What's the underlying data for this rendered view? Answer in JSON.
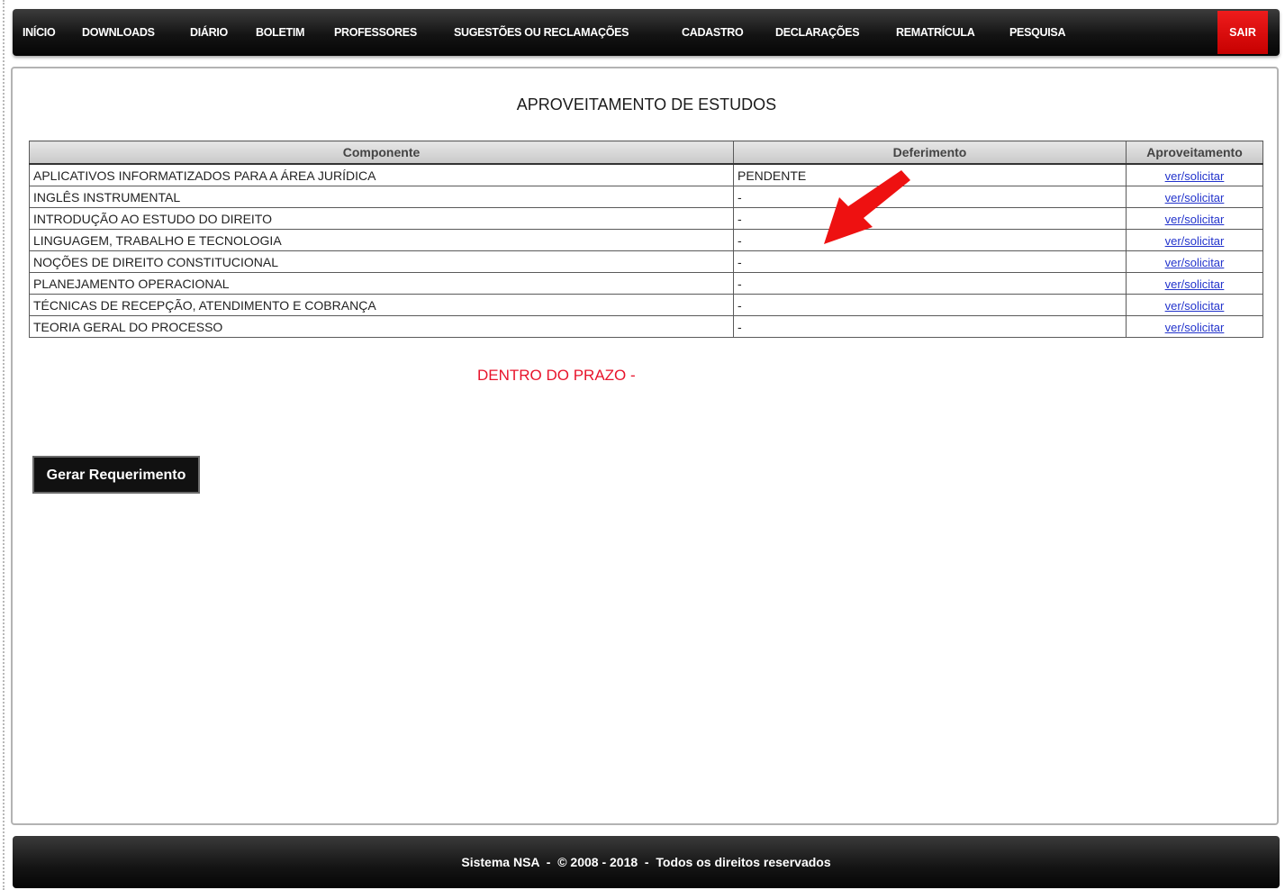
{
  "nav": {
    "items": [
      "INÍCIO",
      "DOWNLOADS",
      "DIÁRIO",
      "BOLETIM",
      "PROFESSORES",
      "SUGESTÕES OU RECLAMAÇÕES",
      "CADASTRO",
      "DECLARAÇÕES",
      "REMATRÍCULA",
      "PESQUISA"
    ],
    "logout_label": "SAIR"
  },
  "page": {
    "title": "APROVEITAMENTO DE ESTUDOS"
  },
  "table": {
    "headers": [
      "Componente",
      "Deferimento",
      "Aproveitamento"
    ],
    "rows": [
      {
        "componente": "APLICATIVOS INFORMATIZADOS PARA A ÁREA JURÍDICA",
        "deferimento": "PENDENTE",
        "aproveitamento": "ver/solicitar"
      },
      {
        "componente": "INGLÊS INSTRUMENTAL",
        "deferimento": "-",
        "aproveitamento": "ver/solicitar"
      },
      {
        "componente": "INTRODUÇÃO AO ESTUDO DO DIREITO",
        "deferimento": "-",
        "aproveitamento": "ver/solicitar"
      },
      {
        "componente": "LINGUAGEM, TRABALHO E TECNOLOGIA",
        "deferimento": "-",
        "aproveitamento": "ver/solicitar"
      },
      {
        "componente": "NOÇÕES DE DIREITO CONSTITUCIONAL",
        "deferimento": "-",
        "aproveitamento": "ver/solicitar"
      },
      {
        "componente": "PLANEJAMENTO OPERACIONAL",
        "deferimento": "-",
        "aproveitamento": "ver/solicitar"
      },
      {
        "componente": "TÉCNICAS DE RECEPÇÃO, ATENDIMENTO E COBRANÇA",
        "deferimento": "-",
        "aproveitamento": "ver/solicitar"
      },
      {
        "componente": "TEORIA GERAL DO PROCESSO",
        "deferimento": "-",
        "aproveitamento": "ver/solicitar"
      }
    ]
  },
  "status": {
    "text": "DENTRO DO PRAZO -"
  },
  "actions": {
    "generate_label": "Gerar Requerimento"
  },
  "footer": {
    "text": "Sistema NSA  -  © 2008 - 2018  -  Todos os direitos reservados"
  },
  "annotation": {
    "icon": "red-arrow-icon",
    "color": "#ee1111"
  },
  "colors": {
    "nav_bg": "#141414",
    "logout_bg": "#d90000",
    "status_red": "#e8132b",
    "link_blue": "#2233cc"
  }
}
